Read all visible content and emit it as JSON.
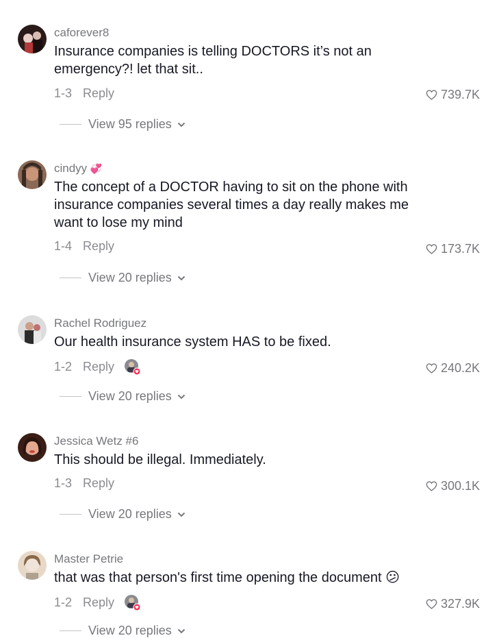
{
  "comments": [
    {
      "username": "caforever8",
      "text": "Insurance companies is telling DOCTORS it’s not an emergency?! let that sit..",
      "date": "1-3",
      "reply_label": "Reply",
      "likes": "739.7K",
      "view_replies": "View 95 replies",
      "avatar_colors": [
        "#2a1a1a",
        "#b23a3a",
        "#e8d0c8"
      ]
    },
    {
      "username": "cindyy",
      "username_emoji": "💞",
      "text": "The concept of a DOCTOR having to sit on the phone with insurance companies several times a day really makes me want to lose my mind",
      "date": "1-4",
      "reply_label": "Reply",
      "likes": "173.7K",
      "view_replies": "View 20 replies",
      "avatar_colors": [
        "#6b4a36",
        "#c99478",
        "#3a2a22"
      ]
    },
    {
      "username": "Rachel Rodriguez",
      "text": "Our health insurance system HAS to be fixed.",
      "date": "1-2",
      "reply_label": "Reply",
      "likes": "240.2K",
      "view_replies": "View 20 replies",
      "avatar_colors": [
        "#dcdcdc",
        "#2b2b2b",
        "#c07070"
      ]
    },
    {
      "username": "Jessica Wetz #6",
      "text": "This should be illegal. Immediately.",
      "date": "1-3",
      "reply_label": "Reply",
      "likes": "300.1K",
      "view_replies": "View 20 replies",
      "avatar_colors": [
        "#3a1e16",
        "#c8443c",
        "#e2a890"
      ]
    },
    {
      "username": "Master Petrie",
      "text": "that was that person's first time opening the document",
      "text_emoji": "😕",
      "date": "1-2",
      "reply_label": "Reply",
      "likes": "327.9K",
      "view_replies": "View 20 replies",
      "avatar_colors": [
        "#e8d8c8",
        "#8a6a4a",
        "#f0e4da"
      ]
    }
  ],
  "colors": {
    "text": "#161823",
    "secondary": "#75777c",
    "creator_badge": "#fe2c55"
  }
}
